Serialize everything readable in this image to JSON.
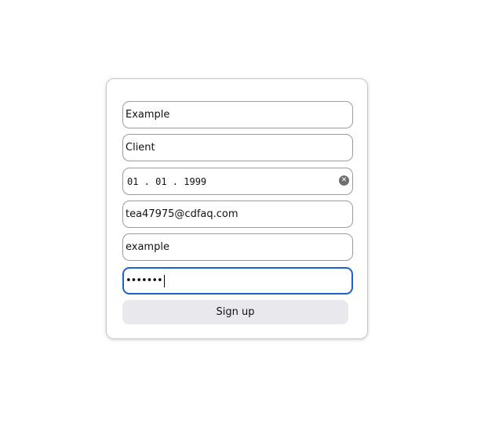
{
  "form": {
    "first_name": "Example",
    "last_name": "Client",
    "birth_date": "01 . 01 . 1999",
    "email": "tea47975@cdfaq.com",
    "username": "example",
    "password_masked": "•••••••",
    "submit_label": "Sign up"
  },
  "icons": {
    "date_clear": "clear-circle-x"
  },
  "colors": {
    "focus_border": "#1a64c8",
    "field_border": "#9c9c9c",
    "button_bg": "#e9e9ed"
  }
}
